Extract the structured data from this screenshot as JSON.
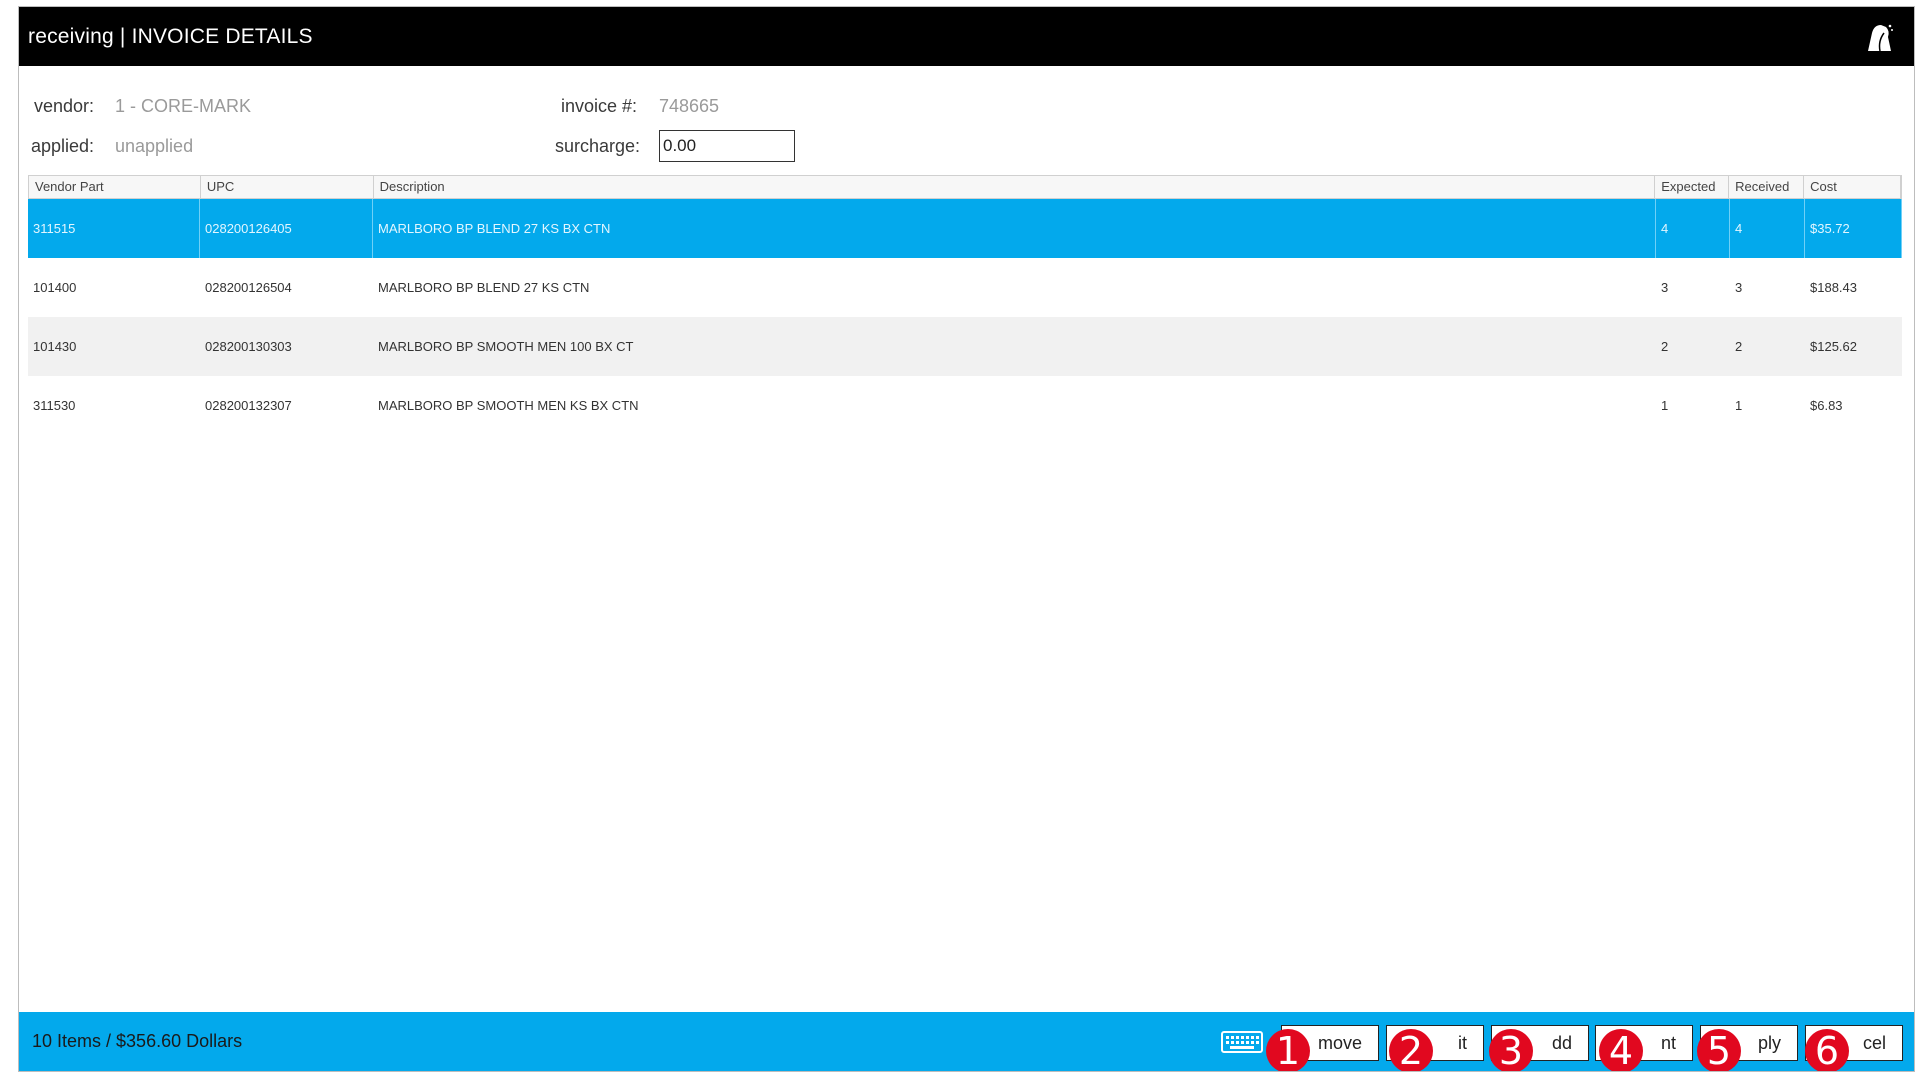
{
  "window": {
    "title": "receiving | INVOICE DETAILS",
    "logo_icon": "bell-logo-icon"
  },
  "header": {
    "vendor_label": "vendor:",
    "vendor_value": "1 - CORE-MARK",
    "applied_label": "applied:",
    "applied_value": "unapplied",
    "invoice_label": "invoice #:",
    "invoice_value": "748665",
    "surcharge_label": "surcharge:",
    "surcharge_value": "0.00"
  },
  "table": {
    "columns": [
      "Vendor Part",
      "UPC",
      "Description",
      "Expected",
      "Received",
      "Cost"
    ],
    "selected_index": 0,
    "rows": [
      {
        "vendor_part": "311515",
        "upc": "028200126405",
        "description": "MARLBORO BP BLEND 27 KS BX CTN",
        "expected": "4",
        "received": "4",
        "cost": "$35.72"
      },
      {
        "vendor_part": "101400",
        "upc": "028200126504",
        "description": "MARLBORO BP BLEND 27 KS CTN",
        "expected": "3",
        "received": "3",
        "cost": "$188.43"
      },
      {
        "vendor_part": "101430",
        "upc": "028200130303",
        "description": "MARLBORO BP SMOOTH MEN 100 BX CT",
        "expected": "2",
        "received": "2",
        "cost": "$125.62"
      },
      {
        "vendor_part": "311530",
        "upc": "028200132307",
        "description": "MARLBORO BP SMOOTH MEN KS BX CTN",
        "expected": "1",
        "received": "1",
        "cost": "$6.83"
      }
    ]
  },
  "footer": {
    "summary": "10 Items / $356.60 Dollars",
    "keyboard_icon": "keyboard-icon",
    "buttons": [
      {
        "label": "move",
        "badge": "1"
      },
      {
        "label": "it",
        "badge": "2"
      },
      {
        "label": "dd",
        "badge": "3"
      },
      {
        "label": "nt",
        "badge": "4"
      },
      {
        "label": "ply",
        "badge": "5"
      },
      {
        "label": "cel",
        "badge": "6"
      }
    ]
  },
  "colors": {
    "accent": "#03a9ec",
    "titlebar": "#000000",
    "badge": "#e1081f"
  }
}
